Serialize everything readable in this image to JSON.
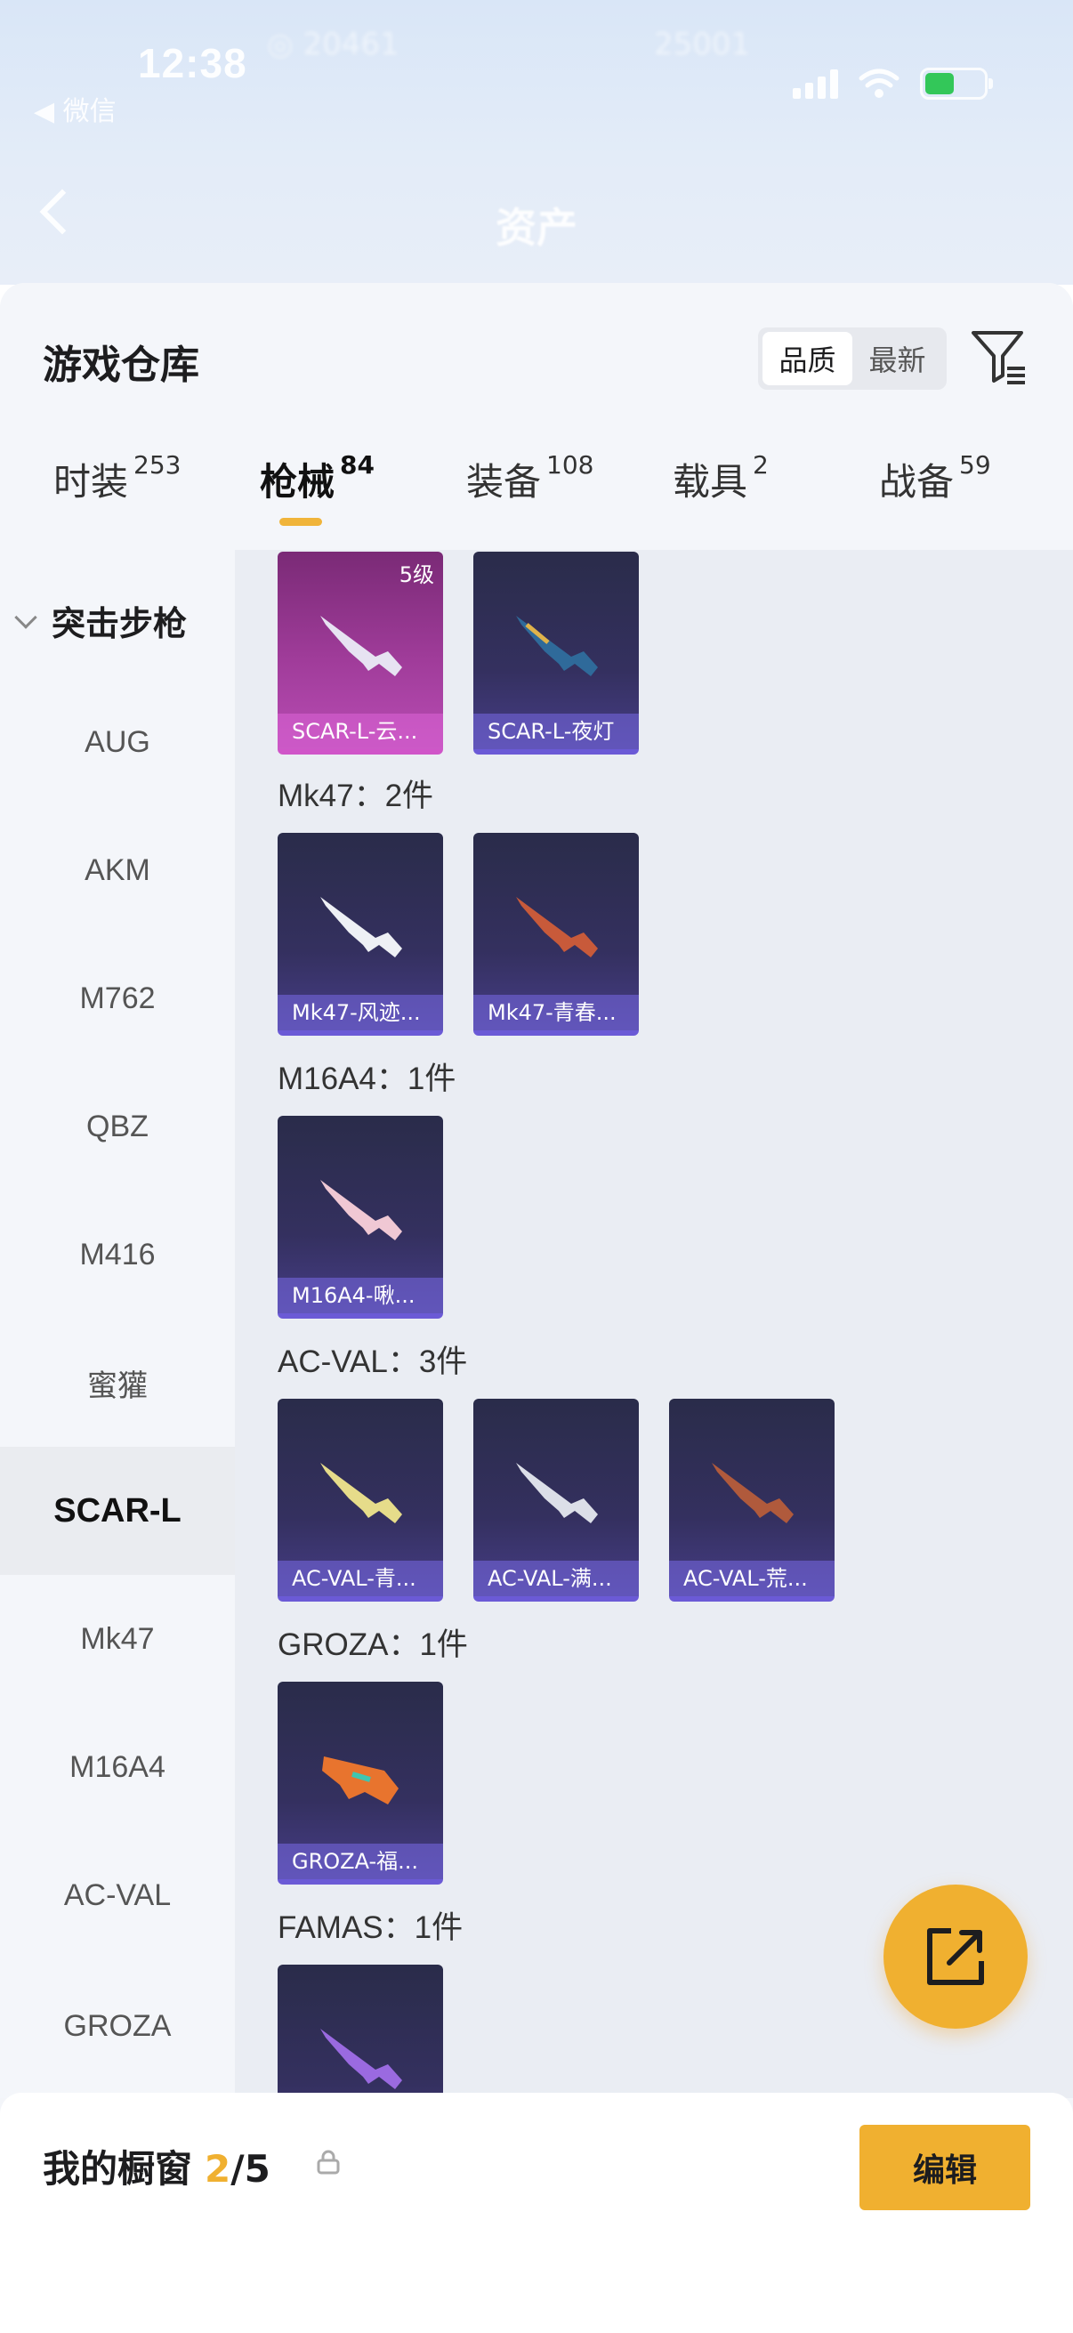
{
  "status_bar": {
    "time": "12:38",
    "back_app": "◀ 微信"
  },
  "background_page": {
    "title": "资产"
  },
  "header": {
    "title": "游戏仓库",
    "sort_options": [
      "品质",
      "最新"
    ],
    "selected_sort": "品质"
  },
  "tabs": [
    {
      "label": "时装",
      "count": "253"
    },
    {
      "label": "枪械",
      "count": "84"
    },
    {
      "label": "装备",
      "count": "108"
    },
    {
      "label": "载具",
      "count": "2"
    },
    {
      "label": "战备",
      "count": "59"
    }
  ],
  "active_tab": "枪械",
  "sidebar": {
    "category": "突击步枪",
    "items": [
      "AUG",
      "AKM",
      "M762",
      "QBZ",
      "M416",
      "蜜獾",
      "SCAR-L",
      "Mk47",
      "M16A4",
      "AC-VAL",
      "GROZA"
    ],
    "active_item": "SCAR-L"
  },
  "groups": [
    {
      "label": "",
      "items": [
        {
          "name": "SCAR-L-云...",
          "level": "5级",
          "rarity": "purple"
        },
        {
          "name": "SCAR-L-夜灯",
          "level": "",
          "rarity": "blue"
        }
      ]
    },
    {
      "label": "Mk47：2件",
      "items": [
        {
          "name": "Mk47-风迹...",
          "rarity": "blue"
        },
        {
          "name": "Mk47-青春...",
          "rarity": "blue"
        }
      ]
    },
    {
      "label": "M16A4：1件",
      "items": [
        {
          "name": "M16A4-啾...",
          "rarity": "blue"
        }
      ]
    },
    {
      "label": "AC-VAL：3件",
      "items": [
        {
          "name": "AC-VAL-青...",
          "rarity": "blue"
        },
        {
          "name": "AC-VAL-满...",
          "rarity": "blue"
        },
        {
          "name": "AC-VAL-荒...",
          "rarity": "blue"
        }
      ]
    },
    {
      "label": "GROZA：1件",
      "items": [
        {
          "name": "GROZA-福...",
          "rarity": "blue"
        }
      ]
    },
    {
      "label": "FAMAS：1件",
      "items": [
        {
          "name": "",
          "rarity": "blue"
        }
      ]
    }
  ],
  "showcase": {
    "label": "我的橱窗",
    "used": "2",
    "total": "/5",
    "edit_label": "编辑"
  },
  "colors": {
    "accent": "#f0b030",
    "card_blue": "#34305f",
    "card_purple": "#a03c9a"
  }
}
